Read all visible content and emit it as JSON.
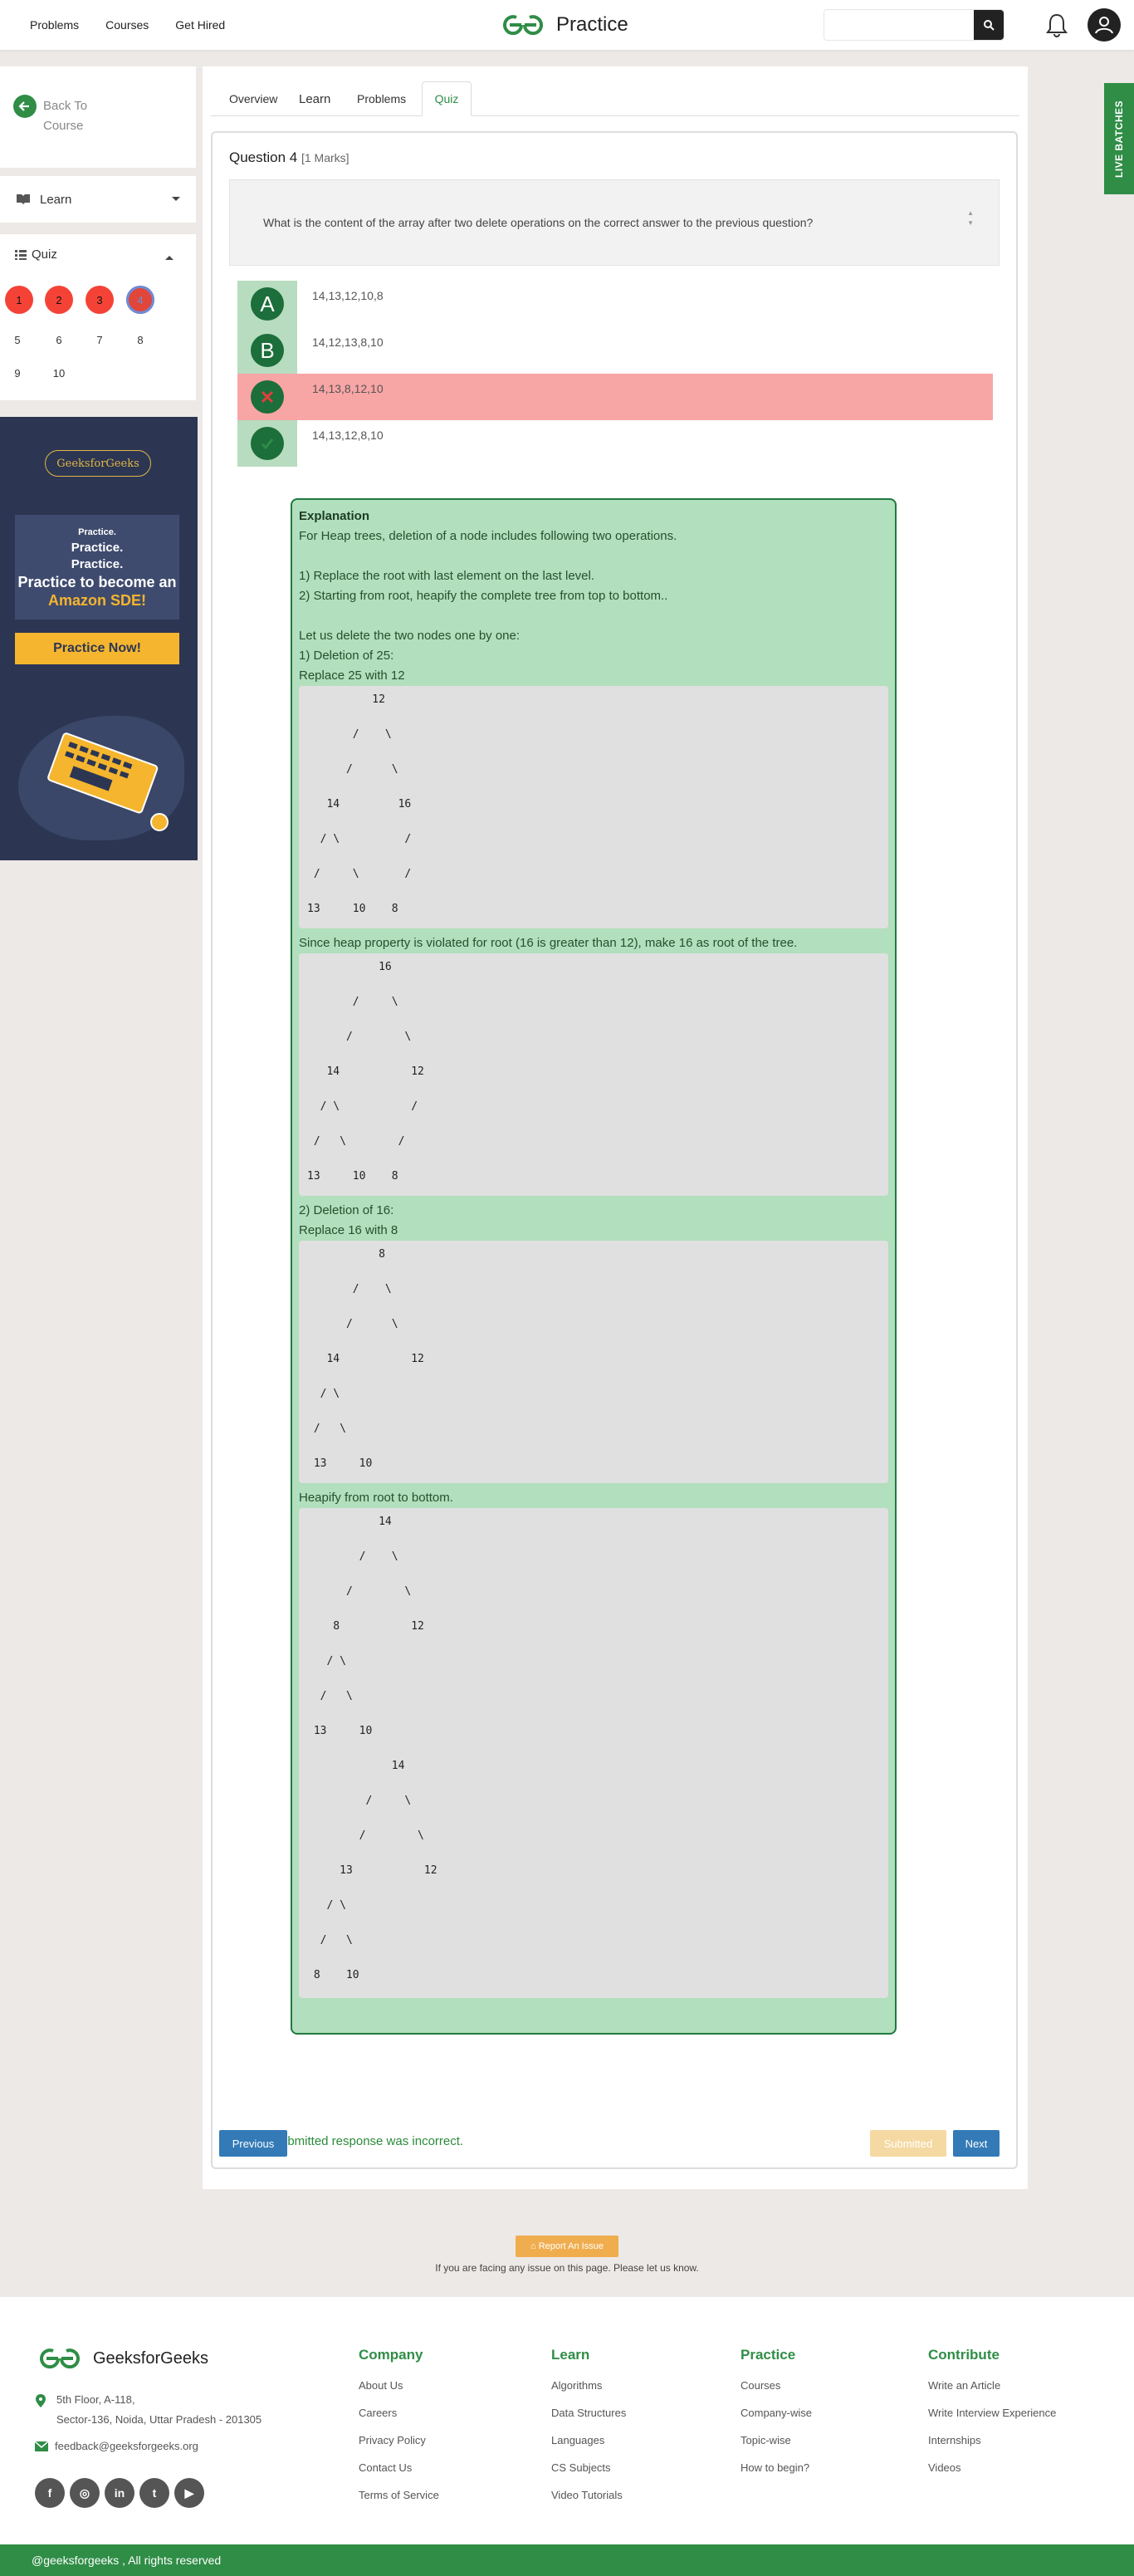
{
  "topnav": {
    "links": [
      "Problems",
      "Courses",
      "Get Hired"
    ],
    "logo_text": "Practice"
  },
  "sidebar": {
    "back_label": "Back To Course",
    "learn_label": "Learn",
    "quiz_label": "Quiz",
    "question_numbers": [
      "1",
      "2",
      "3",
      "4",
      "5",
      "6",
      "7",
      "8",
      "9",
      "10"
    ]
  },
  "ad": {
    "badge": "GeeksforGeeks",
    "line1": "Practice.",
    "line2": "Practice.",
    "line3": "Practice.",
    "line4": "Practice to become an",
    "line5": "Amazon SDE!",
    "button": "Practice Now!"
  },
  "tabs": [
    "Overview",
    "Learn",
    "Problems",
    "Quiz"
  ],
  "active_tab": "Quiz",
  "question": {
    "title": "Question 4",
    "marks": "[1 Marks]",
    "text": "What is the content of the array after two delete operations on the correct answer to the previous question?",
    "options": [
      {
        "letter": "A",
        "text": "14,13,12,10,8"
      },
      {
        "letter": "B",
        "text": "14,12,13,8,10"
      },
      {
        "letter": "",
        "text": "14,13,8,12,10",
        "state": "wrong"
      },
      {
        "letter": "",
        "text": "14,13,12,8,10",
        "state": "correct"
      }
    ]
  },
  "explanation": {
    "title": "Explanation",
    "p1": "For Heap trees, deletion of a node includes following two operations.",
    "p2": "1) Replace the root with last element on the last level.",
    "p3": "2) Starting from root, heapify the complete tree from top to bottom..",
    "p4": "Let us delete the two nodes one by one:",
    "p5": "1) Deletion of 25:",
    "p6": "Replace 25 with 12",
    "tree1": "          12\n\n       /    \\\n\n      /      \\\n\n   14         16\n\n  / \\          /\n\n /     \\       /\n\n13     10    8",
    "p7": "Since heap property is violated for root (16 is greater than 12), make 16 as root of the tree.",
    "tree2": "           16\n\n       /     \\\n\n      /        \\\n\n   14           12\n\n  / \\           /\n\n /   \\        /\n\n13     10    8",
    "p8": "2) Deletion of 16:",
    "p9": "Replace 16 with 8",
    "tree3": "           8\n\n       /    \\\n\n      /      \\\n\n   14           12\n\n  / \\\n\n /   \\\n\n 13     10",
    "p10": "Heapify from root to bottom.",
    "tree4": "           14\n\n        /    \\\n\n      /        \\\n\n    8           12\n\n   / \\\n\n  /   \\\n\n 13     10\n\n             14\n\n         /     \\\n\n        /        \\\n\n     13           12\n\n   / \\\n\n  /   \\\n\n 8    10"
  },
  "result_text": "Your submitted response was incorrect.",
  "buttons": {
    "previous": "Previous",
    "submitted": "Submitted",
    "next": "Next"
  },
  "report": {
    "button": "Report An Issue",
    "text": "If you are facing any issue on this page. Please let us know."
  },
  "live_batches": "LIVE BATCHES",
  "footer": {
    "brand": "GeeksforGeeks",
    "address_line1": "5th Floor, A-118,",
    "address_line2": "Sector-136, Noida, Uttar Pradesh - 201305",
    "email": "feedback@geeksforgeeks.org",
    "columns": [
      {
        "title": "Company",
        "items": [
          "About Us",
          "Careers",
          "Privacy Policy",
          "Contact Us",
          "Terms of Service"
        ]
      },
      {
        "title": "Learn",
        "items": [
          "Algorithms",
          "Data Structures",
          "Languages",
          "CS Subjects",
          "Video Tutorials"
        ]
      },
      {
        "title": "Practice",
        "items": [
          "Courses",
          "Company-wise",
          "Topic-wise",
          "How to begin?"
        ]
      },
      {
        "title": "Contribute",
        "items": [
          "Write an Article",
          "Write Interview Experience",
          "Internships",
          "Videos"
        ]
      }
    ],
    "copyright": "@geeksforgeeks , All rights reserved"
  },
  "colors": {
    "brand": "#2f8d46",
    "explain_bg": "#b2dfbd",
    "wrong_bg": "#f8a5a5"
  }
}
